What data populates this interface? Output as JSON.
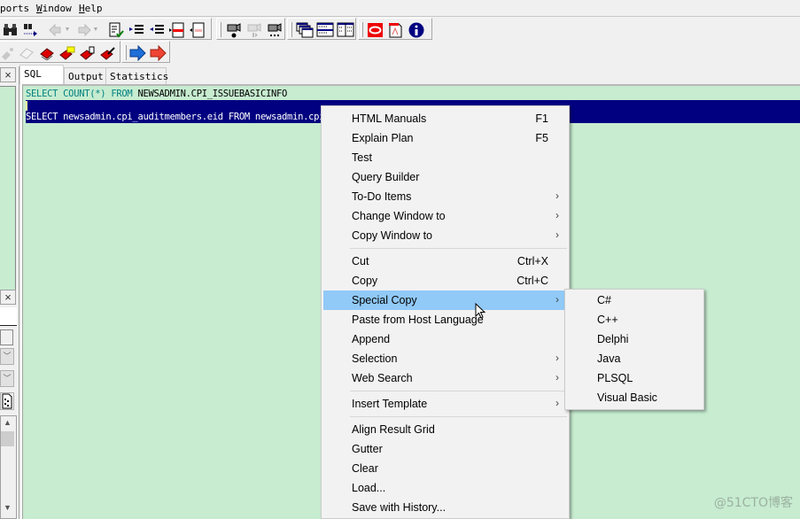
{
  "menubar": {
    "items": [
      {
        "label": "ports",
        "underline": ""
      },
      {
        "label_rest": "indow",
        "underline": "W"
      },
      {
        "label_rest": "elp",
        "underline": "H"
      }
    ]
  },
  "toolbar": {
    "row1": [
      "find-icon",
      "find-next-icon",
      "back-icon",
      "back-dropdown-icon",
      "forward-icon",
      "forward-dropdown-icon",
      "verify-icon",
      "indent-icon",
      "unindent-icon",
      "comment-icon",
      "uncomment-icon",
      "record-macro-icon",
      "play-macro-icon",
      "macro-library-icon",
      "cascade-windows-icon",
      "tile-horizontal-icon",
      "tile-vertical-icon",
      "oracle-icon",
      "pdf-icon",
      "info-icon"
    ],
    "row2": [
      "disabled-star-icon",
      "disabled-eraser-icon",
      "books-icon",
      "books-folder-icon",
      "books-copy-icon",
      "books-edit-icon",
      "navigate-back-icon",
      "navigate-forward-icon"
    ]
  },
  "left_panel": {
    "close_label": "×"
  },
  "tabs": [
    {
      "label": "SQL",
      "active": true
    },
    {
      "label": "Output",
      "active": false
    },
    {
      "label": "Statistics",
      "active": false
    }
  ],
  "editor": {
    "line1": {
      "kw1": "SELECT COUNT(*) FROM ",
      "ident": "NEWSADMIN.CPI_ISSUEBASICINFO"
    },
    "line3": "SELECT newsadmin.cpi_auditmembers.eid FROM newsadmin.cpi"
  },
  "context_menu": {
    "groups": [
      [
        {
          "label": "HTML Manuals",
          "shortcut": "F1"
        },
        {
          "label": "Explain Plan",
          "shortcut": "F5"
        },
        {
          "label": "Test"
        },
        {
          "label": "Query Builder"
        },
        {
          "label": "To-Do Items",
          "submenu": true
        },
        {
          "label": "Change Window to",
          "submenu": true
        },
        {
          "label": "Copy Window to",
          "submenu": true
        }
      ],
      [
        {
          "label": "Cut",
          "shortcut": "Ctrl+X"
        },
        {
          "label": "Copy",
          "shortcut": "Ctrl+C"
        },
        {
          "label": "Special Copy",
          "submenu": true,
          "highlighted": true
        },
        {
          "label": "Paste from Host Language"
        },
        {
          "label": "Append"
        },
        {
          "label": "Selection",
          "submenu": true
        },
        {
          "label": "Web Search",
          "submenu": true
        }
      ],
      [
        {
          "label": "Insert Template",
          "submenu": true
        }
      ],
      [
        {
          "label": "Align Result Grid"
        },
        {
          "label": "Gutter"
        },
        {
          "label": "Clear"
        },
        {
          "label": "Load..."
        },
        {
          "label": "Save with History..."
        }
      ]
    ],
    "submenu_arrow": "›"
  },
  "special_copy_submenu": {
    "items": [
      "C#",
      "C++",
      "Delphi",
      "Java",
      "PLSQL",
      "Visual Basic"
    ]
  },
  "watermark": "@51CTO博客",
  "colors": {
    "editor_bg": "#c7ecd0",
    "selection_bg": "#000080",
    "keyword": "#008080",
    "menu_highlight": "#91c9f7"
  }
}
